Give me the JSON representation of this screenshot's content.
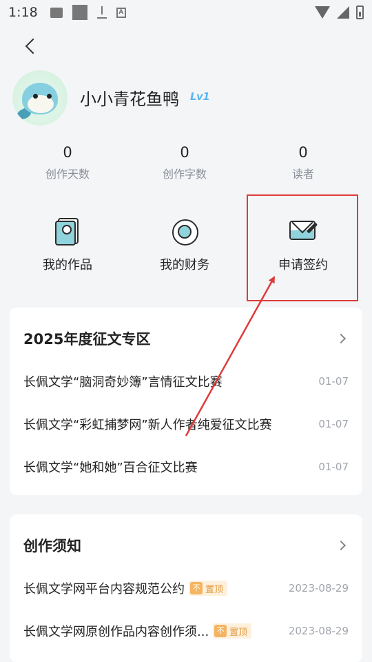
{
  "status_bar": {
    "time": "1:18",
    "icons_left": [
      "image-icon",
      "square-icon",
      "download-icon",
      "a-icon"
    ],
    "icons_right": [
      "wifi-icon",
      "signal-icon",
      "battery-icon"
    ]
  },
  "profile": {
    "name": "小小青花鱼鸭",
    "level": "Lv1"
  },
  "stats": [
    {
      "value": "0",
      "label": "创作天数"
    },
    {
      "value": "0",
      "label": "创作字数"
    },
    {
      "value": "0",
      "label": "读者"
    }
  ],
  "actions": [
    {
      "label": "我的作品",
      "icon": "works-icon"
    },
    {
      "label": "我的财务",
      "icon": "finance-icon"
    },
    {
      "label": "申请签约",
      "icon": "sign-contract-icon"
    }
  ],
  "annotation": {
    "highlight_color": "#e03a3a"
  },
  "contest_section": {
    "title": "2025年度征文专区",
    "items": [
      {
        "text": "长佩文学“脑洞奇妙簿”言情征文比赛",
        "date": "01-07"
      },
      {
        "text": "长佩文学“彩虹捕梦网”新人作者纯爱征文比赛",
        "date": "01-07"
      },
      {
        "text": "长佩文学“她和她”百合征文比赛",
        "date": "01-07"
      }
    ]
  },
  "notice_section": {
    "title": "创作须知",
    "items": [
      {
        "text": "长佩文学网平台内容规范公约",
        "badge_icon": "不",
        "badge": "置顶",
        "date": "2023-08-29"
      },
      {
        "text": "长佩文学网原创作品内容创作须...",
        "badge_icon": "不",
        "badge": "置顶",
        "date": "2023-08-29"
      }
    ]
  }
}
